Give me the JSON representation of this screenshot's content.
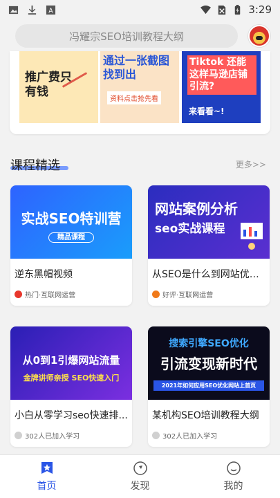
{
  "status_bar": {
    "time": "3:29",
    "icons": [
      "image-icon",
      "download-icon",
      "text-a-icon",
      "wifi-icon",
      "no-sim-icon",
      "battery-icon"
    ]
  },
  "header": {
    "search_placeholder": "冯耀宗SEO培训教程大纲"
  },
  "banners": [
    {
      "text": "推广费只有钱",
      "sub": ""
    },
    {
      "text": "通过一张截图找到出",
      "sub": "资料点击抢先看"
    },
    {
      "text": "Tiktok 还能这样马逊店铺引流?",
      "sub": "来看看~!"
    }
  ],
  "section": {
    "title": "课程精选",
    "more": "更多>>"
  },
  "courses": [
    {
      "title": "逆东黑帽视频",
      "meta": "热门·互联网运营",
      "thumb_line1": "实战SEO特训营",
      "thumb_line2": "精品课程",
      "meta_color": "#e8372c"
    },
    {
      "title": "从SEO是什么到网站优化...",
      "meta": "好评·互联网运营",
      "thumb_line1": "网站案例分析",
      "thumb_line2": "seo实战课程",
      "meta_color": "#f07a1a"
    },
    {
      "title": "小白从零学习seo快速排...",
      "meta": "302人已加入学习",
      "thumb_line1": "从0到1引爆网站流量",
      "thumb_line2": "金牌讲师亲授 SEO快速入门",
      "meta_color": "#cccccc"
    },
    {
      "title": "某机构SEO培训教程大纲",
      "meta": "302人已加入学习",
      "thumb_line1": "搜索引擎SEO优化",
      "thumb_line2": "引流变现新时代",
      "thumb_line3": "2021年如何应用SEO优化网站上首页",
      "meta_color": "#cccccc"
    }
  ],
  "tabs": [
    {
      "label": "首页",
      "icon": "home-star-icon",
      "active": true
    },
    {
      "label": "发现",
      "icon": "compass-icon",
      "active": false
    },
    {
      "label": "我的",
      "icon": "smiley-icon",
      "active": false
    }
  ],
  "colors": {
    "accent": "#2a55e6",
    "background": "#f2f2f2"
  }
}
